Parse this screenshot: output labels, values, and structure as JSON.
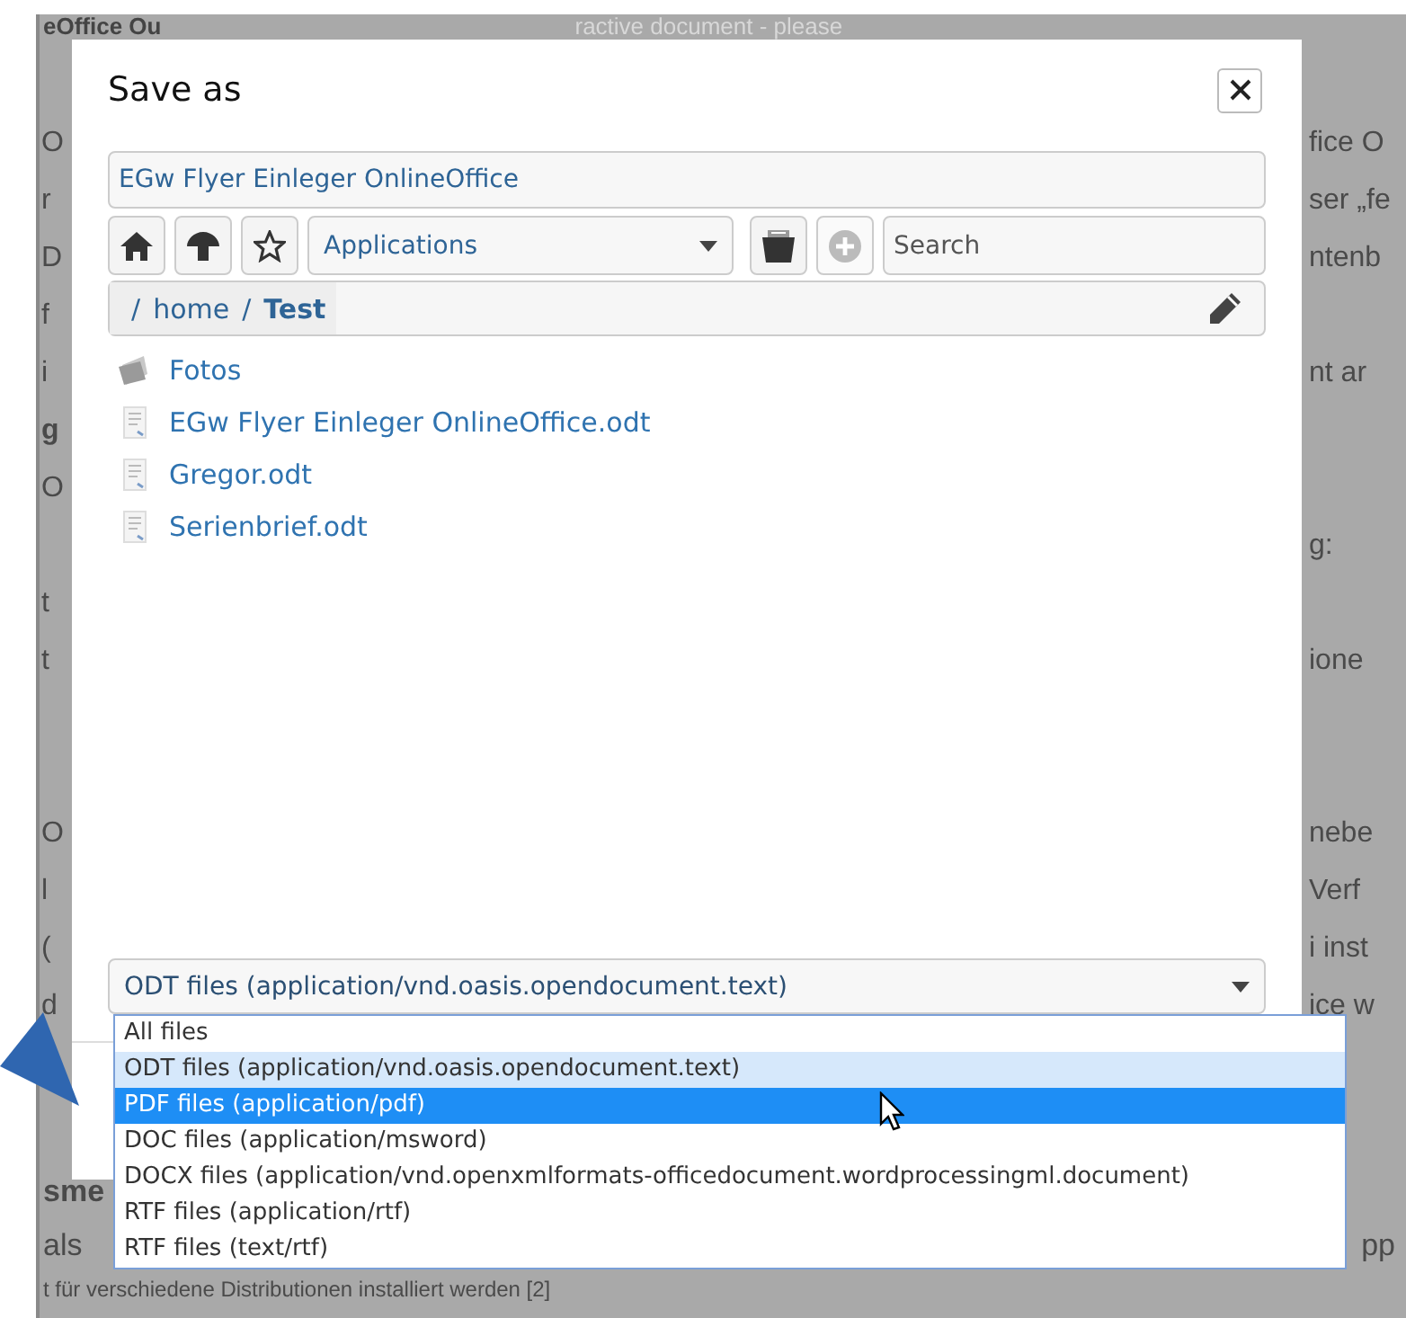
{
  "background": {
    "header_fragments": [
      "eOffice Ou",
      "ractive document - please"
    ],
    "lines": [
      {
        "left": "O",
        "right": "fice O"
      },
      {
        "left": "r",
        "right": "ser „fe"
      },
      {
        "left": "D",
        "right": "ntenb"
      },
      {
        "left": "f"
      },
      {
        "left": "i",
        "right": "nt ar"
      },
      {
        "left": "g"
      },
      {
        "left": "O"
      },
      {
        "right": "g:"
      },
      {
        "left": "t"
      },
      {
        "left": "t",
        "right": "ione"
      },
      {
        "left": "O",
        "right": "nebe"
      },
      {
        "left": "l",
        "right": "Verf"
      },
      {
        "left": "(",
        "right": "i inst"
      },
      {
        "left": "d",
        "right": "ice w"
      }
    ],
    "footer_lines": [
      {
        "left": "sme"
      },
      {
        "left": "als",
        "right": "pp"
      },
      {
        "left": "t für verschiedene Distributionen installiert werden [2]"
      }
    ]
  },
  "dialog": {
    "title": "Save as",
    "filename": "EGw Flyer Einleger OnlineOffice",
    "location": "Applications",
    "add_disabled": true,
    "search_placeholder": "Search",
    "breadcrumb": [
      {
        "separator": "/",
        "label": "home",
        "current": false
      },
      {
        "separator": "/",
        "label": "Test",
        "current": true
      }
    ],
    "files": [
      {
        "name": "Fotos",
        "kind": "folder"
      },
      {
        "name": "EGw Flyer Einleger OnlineOffice.odt",
        "kind": "document"
      },
      {
        "name": "Gregor.odt",
        "kind": "document"
      },
      {
        "name": "Serienbrief.odt",
        "kind": "document"
      }
    ],
    "file_type": "ODT files (application/vnd.oasis.opendocument.text)",
    "file_type_options": [
      {
        "label": "All files",
        "selected": false,
        "hovered": false
      },
      {
        "label": "ODT files (application/vnd.oasis.opendocument.text)",
        "selected": true,
        "hovered": false
      },
      {
        "label": "PDF files (application/pdf)",
        "selected": false,
        "hovered": true
      },
      {
        "label": "DOC files (application/msword)",
        "selected": false,
        "hovered": false
      },
      {
        "label": "DOCX files (application/vnd.openxmlformats-officedocument.wordprocessingml.document)",
        "selected": false,
        "hovered": false
      },
      {
        "label": "RTF files (application/rtf)",
        "selected": false,
        "hovered": false
      },
      {
        "label": "RTF files (text/rtf)",
        "selected": false,
        "hovered": false
      }
    ]
  }
}
